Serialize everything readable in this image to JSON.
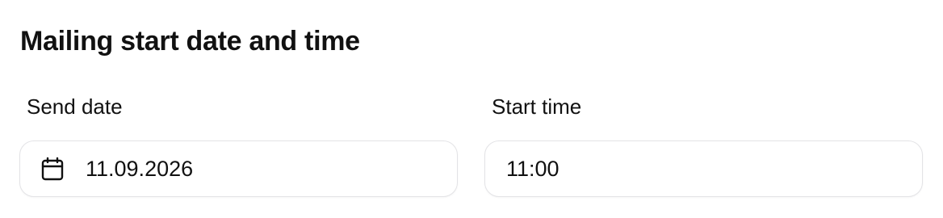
{
  "section": {
    "title": "Mailing start date and time"
  },
  "send_date": {
    "label": "Send date",
    "value": "11.09.2026",
    "icon": "calendar-icon"
  },
  "start_time": {
    "label": "Start time",
    "value": "11:00"
  },
  "colors": {
    "text": "#111111",
    "border": "#e3e3e6",
    "background": "#ffffff"
  }
}
